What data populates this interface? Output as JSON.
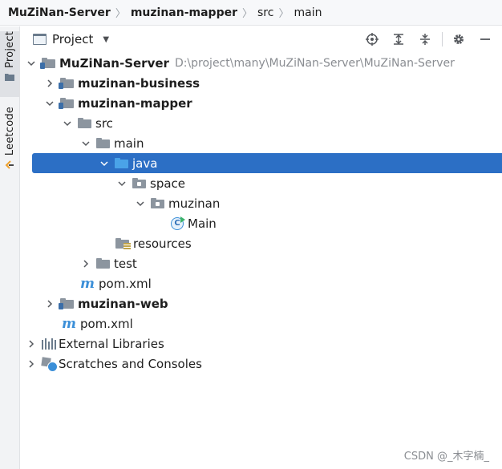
{
  "breadcrumb": {
    "items": [
      "MuZiNan-Server",
      "muzinan-mapper",
      "src",
      "main"
    ]
  },
  "tool_strip": {
    "tabs": [
      {
        "label": "Project",
        "icon": "folder-icon"
      },
      {
        "label": "Leetcode",
        "icon": "leetcode-icon"
      }
    ]
  },
  "project_header": {
    "title": "Project",
    "tools": [
      "locate-icon",
      "expand-all-icon",
      "collapse-all-icon",
      "gear-icon",
      "minimize-icon"
    ]
  },
  "tree": {
    "root": {
      "label": "MuZiNan-Server",
      "path": "D:\\project\\many\\MuZiNan-Server\\MuZiNan-Server"
    },
    "business": "muzinan-business",
    "mapper": "muzinan-mapper",
    "src": "src",
    "main": "main",
    "java": "java",
    "space": "space",
    "muzinan": "muzinan",
    "main_class": "Main",
    "resources": "resources",
    "test": "test",
    "mapper_pom": "pom.xml",
    "web": "muzinan-web",
    "root_pom": "pom.xml",
    "external_libraries": "External Libraries",
    "scratches": "Scratches and Consoles"
  },
  "colors": {
    "selection": "#2c6fc5",
    "folder_gray": "#8c959f",
    "folder_blue": "#4aa3e8",
    "maven_blue": "#3b8fd8"
  },
  "watermark": "CSDN @_木字楠_"
}
